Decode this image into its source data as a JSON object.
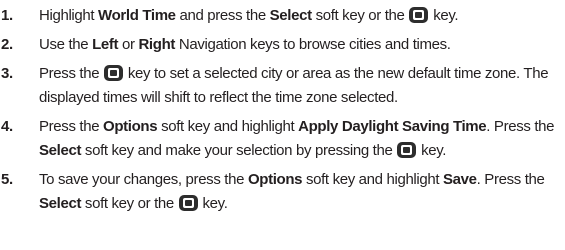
{
  "steps": [
    {
      "number": "1.",
      "parts": [
        {
          "t": "text",
          "v": "Highlight "
        },
        {
          "t": "bold",
          "v": "World Time"
        },
        {
          "t": "text",
          "v": " and press the "
        },
        {
          "t": "bold",
          "v": "Select"
        },
        {
          "t": "text",
          "v": " soft key or the "
        },
        {
          "t": "icon",
          "v": "select-key-icon"
        },
        {
          "t": "text",
          "v": " key."
        }
      ]
    },
    {
      "number": "2.",
      "parts": [
        {
          "t": "text",
          "v": "Use the "
        },
        {
          "t": "bold",
          "v": "Left"
        },
        {
          "t": "text",
          "v": " or "
        },
        {
          "t": "bold",
          "v": "Right"
        },
        {
          "t": "text",
          "v": " Navigation keys to browse cities and times."
        }
      ]
    },
    {
      "number": "3.",
      "parts": [
        {
          "t": "text",
          "v": "Press the "
        },
        {
          "t": "icon",
          "v": "select-key-icon"
        },
        {
          "t": "text",
          "v": " key to set a selected city or area as the new default time zone. The displayed times will shift to reflect the time zone selected."
        }
      ]
    },
    {
      "number": "4.",
      "parts": [
        {
          "t": "text",
          "v": "Press the "
        },
        {
          "t": "bold",
          "v": "Options"
        },
        {
          "t": "text",
          "v": " soft key and highlight "
        },
        {
          "t": "bold",
          "v": "Apply Daylight Saving Time"
        },
        {
          "t": "text",
          "v": ". Press the "
        },
        {
          "t": "bold",
          "v": "Select"
        },
        {
          "t": "text",
          "v": " soft key and make your selection by pressing the "
        },
        {
          "t": "icon",
          "v": "select-key-icon"
        },
        {
          "t": "text",
          "v": " key."
        }
      ]
    },
    {
      "number": "5.",
      "parts": [
        {
          "t": "text",
          "v": "To save your changes, press the "
        },
        {
          "t": "bold",
          "v": "Options"
        },
        {
          "t": "text",
          "v": " soft key and highlight "
        },
        {
          "t": "bold",
          "v": "Save"
        },
        {
          "t": "text",
          "v": ". Press the "
        },
        {
          "t": "bold",
          "v": "Select"
        },
        {
          "t": "text",
          "v": " soft key or the "
        },
        {
          "t": "icon",
          "v": "select-key-icon"
        },
        {
          "t": "text",
          "v": " key."
        }
      ]
    }
  ]
}
